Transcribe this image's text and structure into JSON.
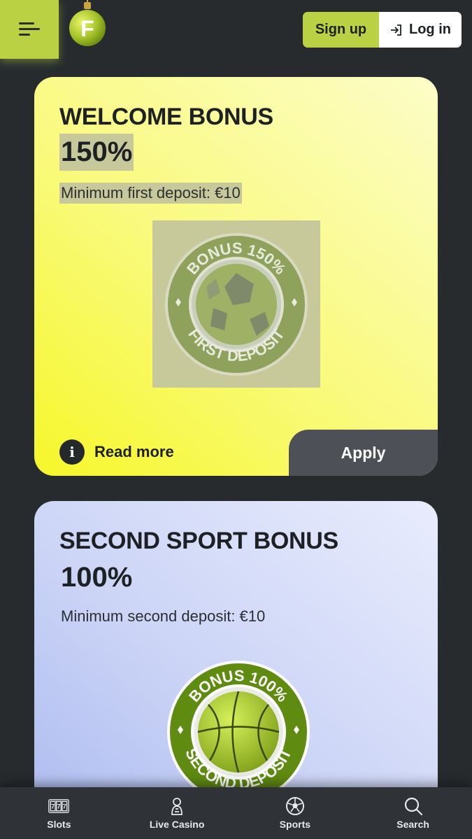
{
  "header": {
    "signup_label": "Sign up",
    "login_label": "Log in",
    "logo_letter": "F"
  },
  "bonuses": [
    {
      "title": "WELCOME BONUS",
      "percent": "150%",
      "min_deposit": "Minimum first deposit: €10",
      "badge_top": "BONUS 150%",
      "badge_bottom": "FIRST DEPOSIT",
      "read_more": "Read more",
      "apply": "Apply"
    },
    {
      "title": "SECOND SPORT BONUS",
      "percent": "100%",
      "min_deposit": "Minimum second deposit: €10",
      "badge_top": "BONUS 100%",
      "badge_bottom": "SECOND DEPOSIT"
    }
  ],
  "bottom_nav": [
    {
      "label": "Slots",
      "icon": "slots-icon"
    },
    {
      "label": "Live Casino",
      "icon": "live-casino-icon"
    },
    {
      "label": "Sports",
      "icon": "sports-ball-icon"
    },
    {
      "label": "Search",
      "icon": "search-icon"
    }
  ],
  "colors": {
    "background": "#272b2e",
    "accent": "#b9d143",
    "card1": "#f6f72a",
    "card2": "#a9b7ef",
    "apply": "#4d5157"
  }
}
